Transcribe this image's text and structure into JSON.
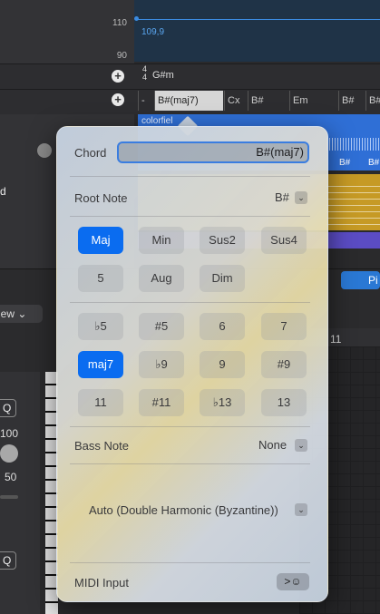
{
  "background": {
    "tempo_ticks": [
      "110",
      "90"
    ],
    "tempo_value": "109,9",
    "time_signature_top": "4",
    "time_signature_bottom": "4",
    "key": "G#m",
    "chord_track": [
      "-",
      "B#(maj7)",
      "Cx",
      "B#",
      "Em",
      "B#",
      "B#"
    ],
    "region_name": "colorfiel",
    "region_chords": [
      "B#",
      "B#"
    ],
    "side_label": "d",
    "view_label": "iew ⌄",
    "pi_label": "Pi",
    "ruler_number": "11",
    "q_label": "Q",
    "knob_value_top": "100",
    "knob_value_bottom": "50",
    "q_label_2": "Q"
  },
  "popover": {
    "chord_label": "Chord",
    "chord_value": "B#(maj7)",
    "root_note_label": "Root Note",
    "root_note_value": "B#",
    "quality_buttons": [
      {
        "label": "Maj",
        "selected": true
      },
      {
        "label": "Min",
        "selected": false
      },
      {
        "label": "Sus2",
        "selected": false
      },
      {
        "label": "Sus4",
        "selected": false
      },
      {
        "label": "5",
        "selected": false
      },
      {
        "label": "Aug",
        "selected": false
      },
      {
        "label": "Dim",
        "selected": false
      }
    ],
    "extension_buttons": [
      {
        "label": "♭5",
        "selected": false
      },
      {
        "label": "#5",
        "selected": false
      },
      {
        "label": "6",
        "selected": false
      },
      {
        "label": "7",
        "selected": false
      },
      {
        "label": "maj7",
        "selected": true
      },
      {
        "label": "♭9",
        "selected": false
      },
      {
        "label": "9",
        "selected": false
      },
      {
        "label": "#9",
        "selected": false
      },
      {
        "label": "11",
        "selected": false
      },
      {
        "label": "#11",
        "selected": false
      },
      {
        "label": "♭13",
        "selected": false
      },
      {
        "label": "13",
        "selected": false
      }
    ],
    "bass_note_label": "Bass Note",
    "bass_note_value": "None",
    "scale_value": "Auto (Double Harmonic (Byzantine))",
    "midi_input_label": "MIDI Input",
    "midi_input_icon": "midi-keyboard-icon"
  },
  "colors": {
    "accent": "#0a6cf0",
    "region_blue": "#2f6fd6",
    "region_yellow": "#c69a25",
    "region_purple": "#5b4cc4"
  }
}
